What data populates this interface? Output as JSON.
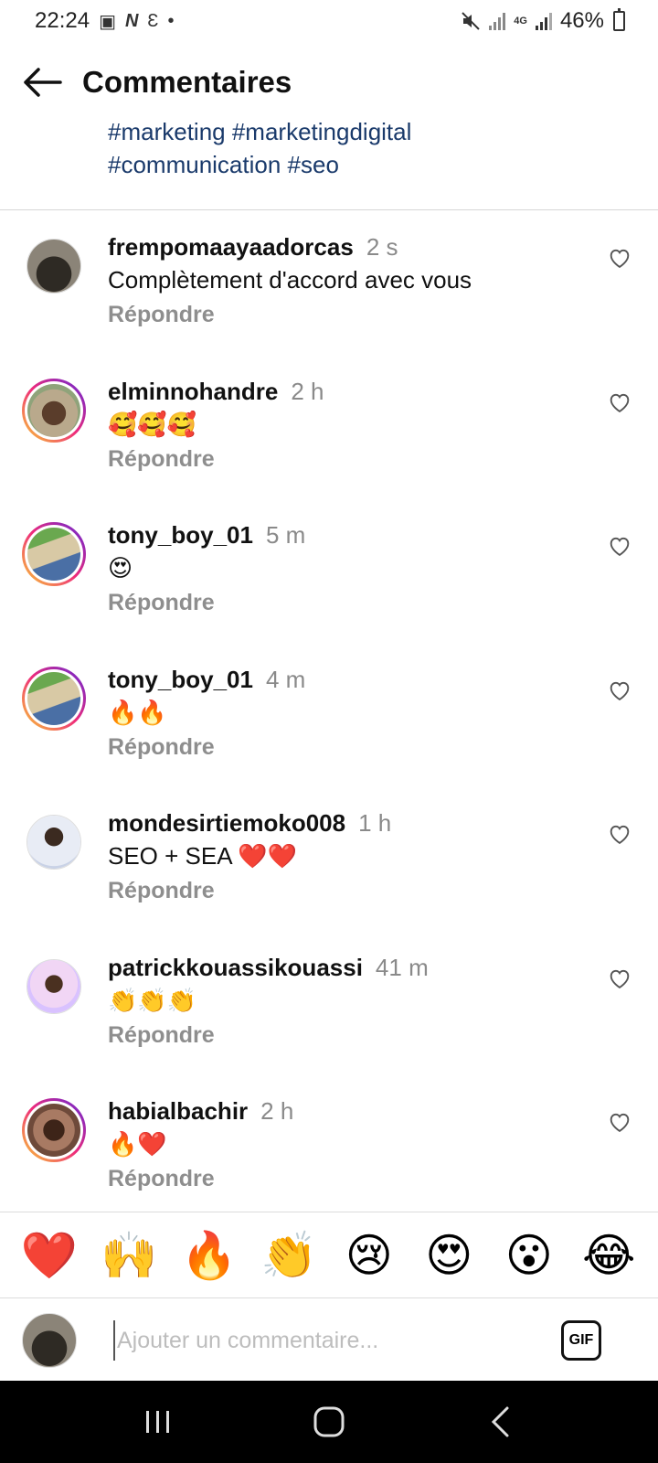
{
  "status_bar": {
    "time": "22:24",
    "battery": "46%",
    "network": "4G"
  },
  "header": {
    "title": "Commentaires"
  },
  "caption": {
    "line1": "#marketing #marketingdigital",
    "line2": "#communication #seo"
  },
  "comments": [
    {
      "username": "frempomaayaadorcas",
      "time": "2 s",
      "text": "Complètement d'accord avec vous",
      "reply": "Répondre"
    },
    {
      "username": "elminnohandre",
      "time": "2 h",
      "text": "🥰🥰🥰",
      "reply": "Répondre"
    },
    {
      "username": "tony_boy_01",
      "time": "5 m",
      "text": "😍",
      "reply": "Répondre"
    },
    {
      "username": "tony_boy_01",
      "time": "4 m",
      "text": "🔥🔥",
      "reply": "Répondre"
    },
    {
      "username": "mondesirtiemoko008",
      "time": "1 h",
      "text": "SEO + SEA ❤️❤️",
      "reply": "Répondre"
    },
    {
      "username": "patrickkouassikouassi",
      "time": "41 m",
      "text": "👏👏👏",
      "reply": "Répondre"
    },
    {
      "username": "habialbachir",
      "time": "2 h",
      "text": "🔥❤️",
      "reply": "Répondre"
    }
  ],
  "quick_emojis": [
    "❤️",
    "🙌",
    "🔥",
    "👏",
    "😢",
    "😍",
    "😮",
    "😂"
  ],
  "composer": {
    "placeholder": "Ajouter un commentaire...",
    "gif_label": "GIF"
  },
  "colors": {
    "hashtag": "#1a3a6b",
    "secondary_text": "#8e8e8e",
    "story_ring": "#ee2a7b"
  }
}
